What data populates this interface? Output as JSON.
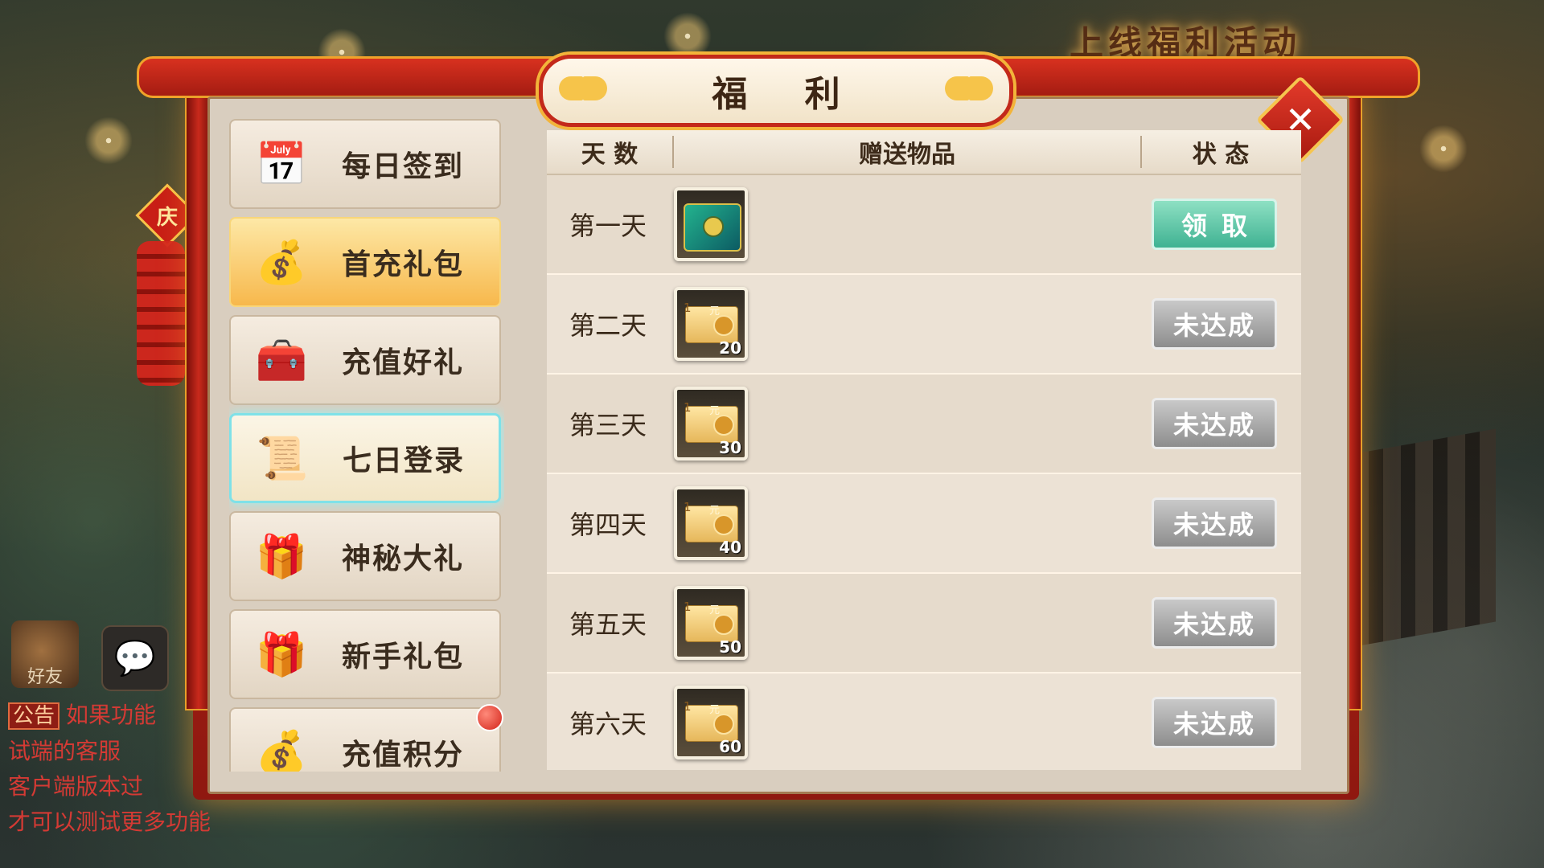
{
  "window": {
    "title": "福  利",
    "close_label": "✕"
  },
  "background": {
    "banner_text": "上线福利活动"
  },
  "menu": {
    "items": [
      {
        "label": "每日签到",
        "icon": "calendar-checkin-icon",
        "glyph": "📅",
        "state": "normal"
      },
      {
        "label": "首充礼包",
        "icon": "money-bag-icon",
        "glyph": "💰",
        "state": "selected"
      },
      {
        "label": "充值好礼",
        "icon": "treasure-chest-icon",
        "glyph": "🧰",
        "state": "normal"
      },
      {
        "label": "七日登录",
        "icon": "calendar-seven-icon",
        "glyph": "📜",
        "state": "highlighted"
      },
      {
        "label": "神秘大礼",
        "icon": "open-chest-icon",
        "glyph": "🎁",
        "state": "normal"
      },
      {
        "label": "新手礼包",
        "icon": "gift-box-icon",
        "glyph": "🎁",
        "state": "normal"
      },
      {
        "label": "充值积分",
        "icon": "gold-chest-icon",
        "glyph": "💰",
        "state": "normal",
        "has_badge": true
      }
    ]
  },
  "table": {
    "headers": {
      "day": "天  数",
      "items": "赠送物品",
      "status": "状  态"
    },
    "rows": [
      {
        "day": "第一天",
        "item_type": "chest",
        "qty": "",
        "status": "领取",
        "claimable": true
      },
      {
        "day": "第二天",
        "item_type": "ticket",
        "qty": "20",
        "status": "未达成",
        "claimable": false
      },
      {
        "day": "第三天",
        "item_type": "ticket",
        "qty": "30",
        "status": "未达成",
        "claimable": false
      },
      {
        "day": "第四天",
        "item_type": "ticket",
        "qty": "40",
        "status": "未达成",
        "claimable": false
      },
      {
        "day": "第五天",
        "item_type": "ticket",
        "qty": "50",
        "status": "未达成",
        "claimable": false
      },
      {
        "day": "第六天",
        "item_type": "ticket",
        "qty": "60",
        "status": "未达成",
        "claimable": false
      }
    ],
    "ticket_one": "1",
    "ticket_yuan": "元"
  },
  "hud": {
    "friend_label": "好友",
    "chat_icon": "chat-bubble-icon",
    "notice_tag": "公告",
    "notice_lines": [
      "如果功能",
      "试端的客服",
      "客户端版本过",
      "才可以测试更多功能"
    ]
  },
  "decor": {
    "seal_char": "庆"
  },
  "colors": {
    "frame_red": "#c0271a",
    "gold_trim": "#f0a32a",
    "claim_green": "#3fb292",
    "locked_gray": "#8d8d8d",
    "notice_red": "#d43a34"
  }
}
